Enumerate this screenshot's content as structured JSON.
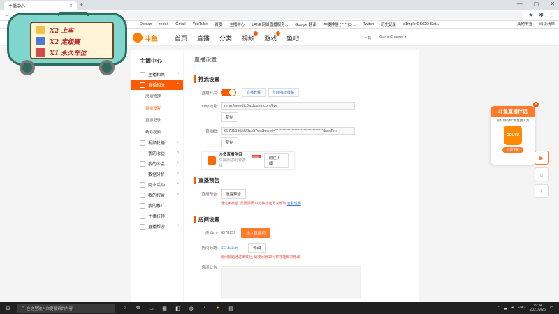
{
  "browser": {
    "tab_title": "主播中心",
    "address": "ⓘ",
    "bookmarks": [
      "Debian",
      "reddit",
      "Gmail",
      "YouTube",
      "百度",
      "主播中心",
      "LANE网络直播服务...",
      "Google 翻译",
      "神楼神楼 ( ^.^ )ン...",
      "Twitch",
      "历史记录",
      "s1mple CS:GO Set..."
    ],
    "bookmarks_right": [
      "其他书签",
      "阅读清单"
    ]
  },
  "ad": {
    "lines": [
      "X2 上车",
      "X2 定级赛",
      "X1 永久车位"
    ]
  },
  "header": {
    "logo_text": "斗鱼",
    "nav": [
      "首页",
      "直播",
      "分类",
      "视频",
      "游戏",
      "鱼吧"
    ],
    "right": [
      "下载",
      "GameChange ▾"
    ]
  },
  "sidebar": {
    "title": "主播中心",
    "items": [
      {
        "label": "主播相关",
        "chev": "^"
      },
      {
        "label": "直播相关",
        "chev": "^",
        "active": true
      }
    ],
    "subitems": [
      {
        "label": "房间管理"
      },
      {
        "label": "直播设置",
        "selected": true
      },
      {
        "label": "直播记录"
      },
      {
        "label": "精彩视频"
      }
    ],
    "items2": [
      {
        "label": "视频轮播",
        "chev": "•"
      },
      {
        "label": "我的收益",
        "chev": "^"
      },
      {
        "label": "我的公会",
        "chev": "^"
      },
      {
        "label": "数据分析",
        "chev": "^"
      },
      {
        "label": "商业活动",
        "chev": "^"
      },
      {
        "label": "我的权益",
        "chev": "^"
      },
      {
        "label": "我的推广",
        "chev": ""
      },
      {
        "label": "主播扶持",
        "chev": ""
      },
      {
        "label": "直播帮游",
        "chev": "^"
      }
    ]
  },
  "main": {
    "title": "直播设置",
    "stream": {
      "section": "推流设置",
      "switch_label": "直播开关:",
      "link1": "直播教程",
      "link2": "切换推流线路",
      "rtmp_label": "rtmp地址:",
      "rtmp_value": "rtmp://sendtc3a.douyu.com/live",
      "copy": "复制",
      "code_label": "直播码:",
      "code_value": "6578159rbtUBzs57wsSecret=********************************&wsTim",
      "promo_title": "斗鱼直播伴侣",
      "promo_sub": "仅需通过1分钟选择",
      "promo_new": "NEW",
      "promo_btn": "前往下载"
    },
    "notice": {
      "section": "直播预告",
      "label": "直播预告:",
      "btn": "设置预告",
      "warn": "通过审核后, 需要间隔10分钟才能再次修改",
      "warn_link": "查看说明"
    },
    "room": {
      "section": "房间设置",
      "id_label": "房间ID:",
      "id_value": "6578159",
      "id_btn": "进入直播间",
      "title_label": "房间标题:",
      "title_value": "SE 上上分",
      "title_btn": "修改",
      "warn": "房间标题通过审核后, 需要间隔10分钟才能再次修改",
      "announce_label": "房间公告:"
    }
  },
  "float": {
    "head": "斗鱼直播伴侣",
    "sub": "最好用的PC端直播工具",
    "app": "DOUYU",
    "btn": "立即下载"
  },
  "taskbar": {
    "search": "在这里输入你要搜索的内容",
    "lang": "ENG",
    "time": "19:34",
    "date": "2021/9/26"
  },
  "colors": {
    "accent": "#ff5a00",
    "link": "#3a7bd5",
    "warn": "#e5463a"
  }
}
